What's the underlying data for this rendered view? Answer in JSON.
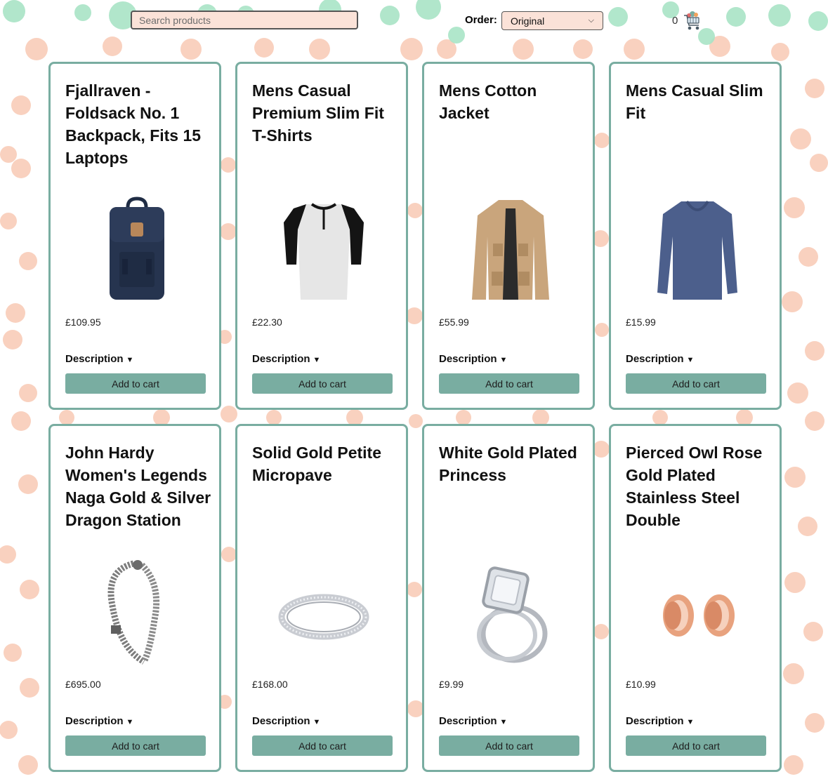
{
  "search": {
    "placeholder": "Search products",
    "value": ""
  },
  "order": {
    "label": "Order:",
    "selected": "Original"
  },
  "cart": {
    "count": "0"
  },
  "colors": {
    "accent": "#79ada1",
    "input_bg": "#fbe2d8",
    "dot_peach": "#f8c9b4",
    "dot_mint": "#a9e4c6"
  },
  "products": [
    {
      "title": "Fjallraven - Foldsack No. 1 Backpack, Fits 15 Laptops",
      "price": "£109.95",
      "description_label": "Description",
      "button_label": "Add to cart",
      "image": "backpack"
    },
    {
      "title": "Mens Casual Premium Slim Fit T-Shirts",
      "price": "£22.30",
      "description_label": "Description",
      "button_label": "Add to cart",
      "image": "raglan-tshirt"
    },
    {
      "title": "Mens Cotton Jacket",
      "price": "£55.99",
      "description_label": "Description",
      "button_label": "Add to cart",
      "image": "jacket"
    },
    {
      "title": "Mens Casual Slim Fit",
      "price": "£15.99",
      "description_label": "Description",
      "button_label": "Add to cart",
      "image": "longsleeve-shirt"
    },
    {
      "title": "John Hardy Women's Legends Naga Gold & Silver Dragon Station",
      "price": "£695.00",
      "description_label": "Description",
      "button_label": "Add to cart",
      "image": "dragon-bracelet"
    },
    {
      "title": "Solid Gold Petite Micropave",
      "price": "£168.00",
      "description_label": "Description",
      "button_label": "Add to cart",
      "image": "pave-ring"
    },
    {
      "title": "White Gold Plated Princess",
      "price": "£9.99",
      "description_label": "Description",
      "button_label": "Add to cart",
      "image": "princess-ring"
    },
    {
      "title": "Pierced Owl Rose Gold Plated Stainless Steel Double",
      "price": "£10.99",
      "description_label": "Description",
      "button_label": "Add to cart",
      "image": "rose-gold-plugs"
    }
  ]
}
